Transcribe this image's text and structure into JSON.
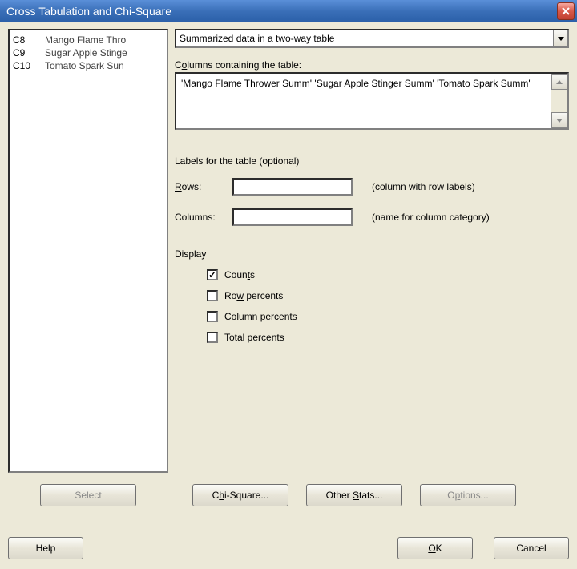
{
  "title": "Cross Tabulation and Chi-Square",
  "listbox": {
    "items": [
      {
        "col": "C8",
        "name": "Mango Flame Thro"
      },
      {
        "col": "C9",
        "name": "Sugar Apple Stinge"
      },
      {
        "col": "C10",
        "name": "Tomato Spark Sun"
      }
    ]
  },
  "data_type": {
    "selected": "Summarized data in a two-way table"
  },
  "columns_table": {
    "label_pre": "C",
    "label_underline": "o",
    "label_post": "lumns containing the table:",
    "value": "'Mango Flame Thrower Summ' 'Sugar Apple Stinger Summ' 'Tomato Spark Summ'"
  },
  "labels_section": {
    "header": "Labels for the table (optional)",
    "rows": {
      "label_pre": "R",
      "label_underline": "o",
      "label_post": "ws:",
      "value": "",
      "hint": "(column with row labels)"
    },
    "columns": {
      "label": "Columns:",
      "value": "",
      "hint": "(name for column category)"
    }
  },
  "display": {
    "header": "Display",
    "counts": {
      "label_pre": "Coun",
      "label_underline": "t",
      "label_post": "s",
      "checked": true
    },
    "row_percents": {
      "label_pre": "Ro",
      "label_underline": "w",
      "label_post": " percents",
      "checked": false
    },
    "column_percents": {
      "label_pre": "Co",
      "label_underline": "l",
      "label_post": "umn percents",
      "checked": false
    },
    "total_percents": {
      "label": "Total percents",
      "checked": false
    }
  },
  "buttons": {
    "select": "Select",
    "chi_square_pre": "C",
    "chi_square_underline": "h",
    "chi_square_post": "i-Square...",
    "other_stats_pre": "Other ",
    "other_stats_underline": "S",
    "other_stats_post": "tats...",
    "options_pre": "O",
    "options_underline": "p",
    "options_post": "tions...",
    "help": "Help",
    "ok_underline": "O",
    "ok_post": "K",
    "cancel": "Cancel"
  }
}
